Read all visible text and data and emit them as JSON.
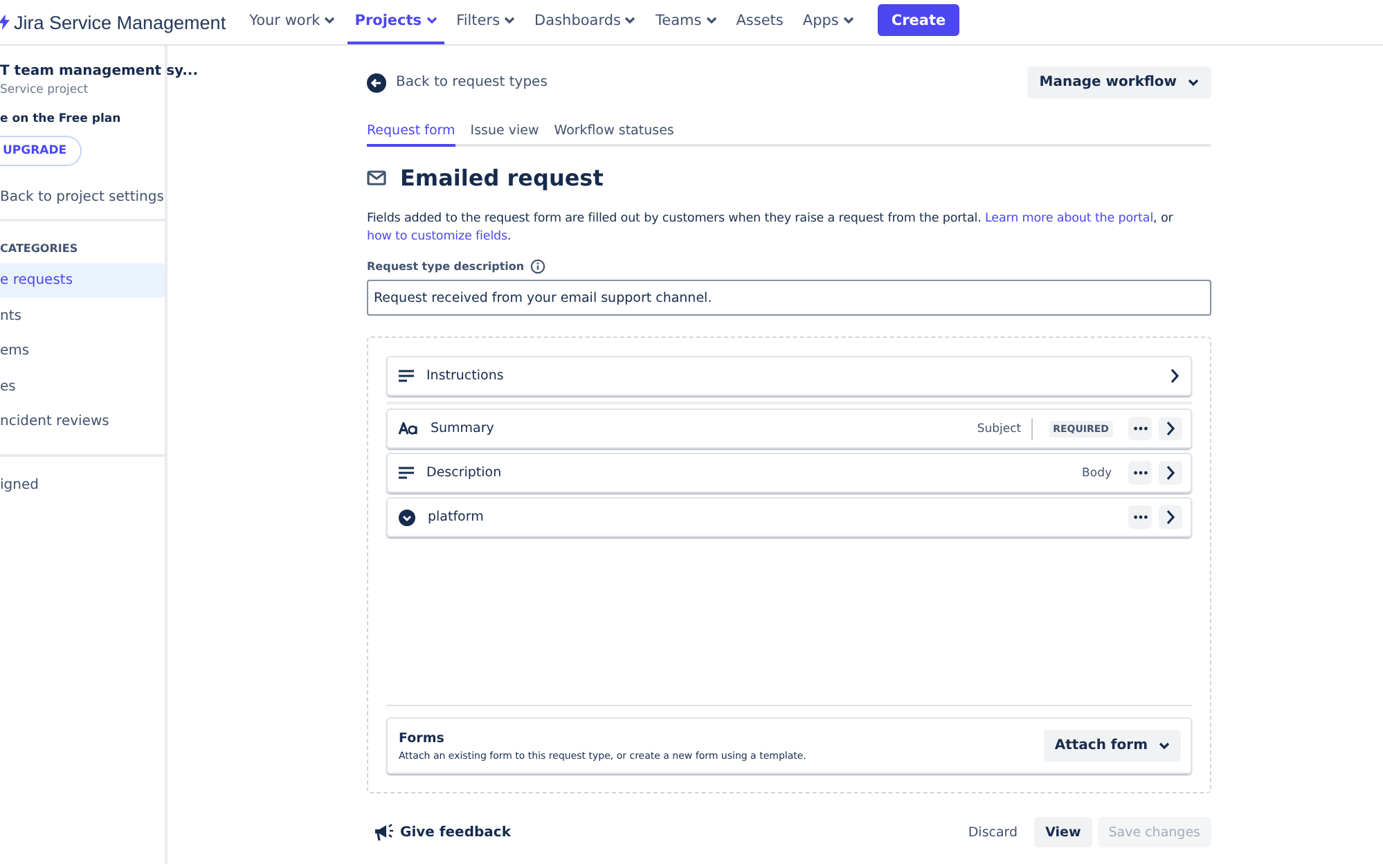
{
  "topnav": {
    "product": "Jira Service Management",
    "items": [
      {
        "label": "Your work",
        "dropdown": true,
        "selected": false
      },
      {
        "label": "Projects",
        "dropdown": true,
        "selected": true
      },
      {
        "label": "Filters",
        "dropdown": true,
        "selected": false
      },
      {
        "label": "Dashboards",
        "dropdown": true,
        "selected": false
      },
      {
        "label": "Teams",
        "dropdown": true,
        "selected": false
      },
      {
        "label": "Assets",
        "dropdown": false,
        "selected": false
      },
      {
        "label": "Apps",
        "dropdown": true,
        "selected": false
      }
    ],
    "create": "Create"
  },
  "sidebar": {
    "project_name": "T team management sy...",
    "project_type": "Service project",
    "plan": "e on the Free plan",
    "upgrade": "UPGRADE",
    "back": "Back to project settings",
    "section": "CATEGORIES",
    "items": [
      {
        "label": "e requests",
        "selected": true
      },
      {
        "label": "nts",
        "selected": false
      },
      {
        "label": "ems",
        "selected": false
      },
      {
        "label": "es",
        "selected": false
      },
      {
        "label": "ncident reviews",
        "selected": false
      }
    ],
    "bottom_item": "igned"
  },
  "header": {
    "back": "Back to request types",
    "manage": "Manage workflow"
  },
  "tabs": [
    {
      "label": "Request form",
      "selected": true
    },
    {
      "label": "Issue view",
      "selected": false
    },
    {
      "label": "Workflow statuses",
      "selected": false
    }
  ],
  "title": "Emailed request",
  "intro": {
    "text": "Fields added to the request form are filled out by customers when they raise a request from the portal. ",
    "link1": "Learn more about the portal",
    "middle": ", or ",
    "link2": "how to customize fields",
    "end": "."
  },
  "description_field": {
    "label": "Request type description",
    "value": "Request received from your email support channel."
  },
  "instructions": {
    "label": "Instructions"
  },
  "fields": [
    {
      "kind": "text",
      "label": "Summary",
      "maps_to": "Subject",
      "required": true,
      "required_label": "REQUIRED"
    },
    {
      "kind": "paragraph",
      "label": "Description",
      "maps_to": "Body",
      "required": false
    },
    {
      "kind": "select",
      "label": "platform",
      "required": false
    }
  ],
  "forms": {
    "title": "Forms",
    "text": "Attach an existing form to this request type, or create a new form using a template.",
    "button": "Attach form"
  },
  "footer": {
    "feedback": "Give feedback",
    "discard": "Discard",
    "view": "View",
    "save": "Save changes",
    "save_disabled": true
  }
}
